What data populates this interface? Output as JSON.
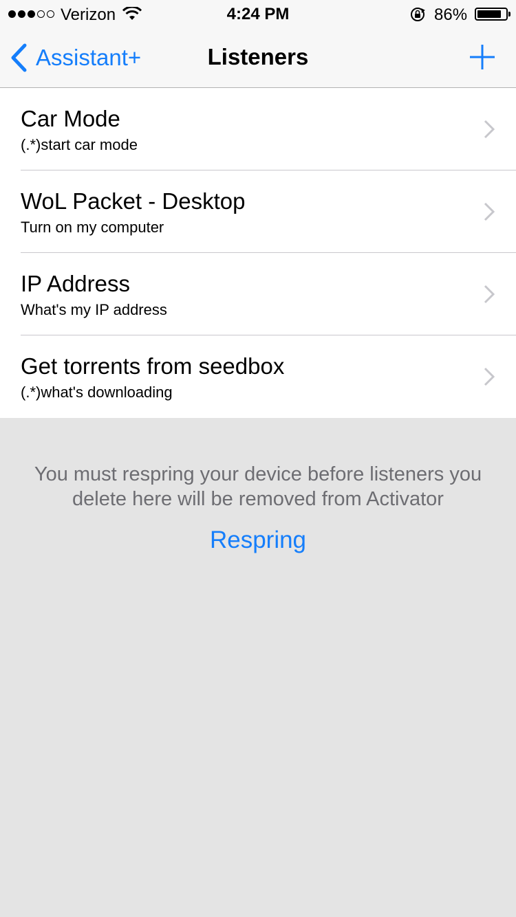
{
  "status_bar": {
    "carrier": "Verizon",
    "time": "4:24 PM",
    "battery_percent": "86%",
    "battery_level": 0.86,
    "signal_bars_filled": 3,
    "signal_bars_total": 5,
    "icons": [
      "wifi-icon",
      "rotation-lock-icon",
      "battery-icon"
    ]
  },
  "nav": {
    "back_label": "Assistant+",
    "title": "Listeners",
    "add_icon": "plus-icon"
  },
  "listeners": [
    {
      "title": "Car Mode",
      "subtitle": "(.*)start car mode"
    },
    {
      "title": "WoL Packet - Desktop",
      "subtitle": "Turn on my computer"
    },
    {
      "title": "IP Address",
      "subtitle": "What's my IP address"
    },
    {
      "title": "Get torrents from seedbox",
      "subtitle": "(.*)what's downloading"
    }
  ],
  "footer": {
    "note_line1": "You must respring your device before listeners you",
    "note_line2": "delete here will be removed from Activator",
    "respring_label": "Respring"
  },
  "colors": {
    "accent": "#157efb",
    "background": "#e4e4e4",
    "nav_background": "#f7f7f7",
    "footer_text": "#6d6d72"
  }
}
